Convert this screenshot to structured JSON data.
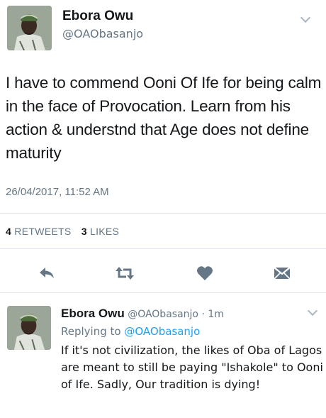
{
  "main_tweet": {
    "author_name": "Ebora Owu",
    "handle": "@OAObasanjo",
    "text": "I have to commend Ooni Of Ife for being calm in the face of Provocation. Learn from his action & understnd that Age does not define maturity",
    "timestamp": "26/04/2017, 11:52 AM",
    "retweets_count": "4",
    "retweets_label": "RETWEETS",
    "likes_count": "3",
    "likes_label": "LIKES"
  },
  "reply_tweet": {
    "author_name": "Ebora Owu",
    "handle": "@OAObasanjo",
    "separator": "·",
    "time_ago": "1m",
    "replying_prefix": "Replying to",
    "replying_to": "@OAObasanjo",
    "text": "If it's not civilization, the likes of Oba of Lagos are meant to still be paying \"Ishakole\" to Ooni of Ife. Sadly, Our tradition is dying!"
  },
  "icons": {
    "reply": "reply-icon",
    "retweet": "retweet-icon",
    "like": "heart-icon",
    "dm": "envelope-icon",
    "more": "chevron-down-icon"
  },
  "colors": {
    "text": "#14171a",
    "muted": "#657786",
    "link": "#1da1f2",
    "icon": "#657786",
    "divider": "#e1e8ed"
  }
}
